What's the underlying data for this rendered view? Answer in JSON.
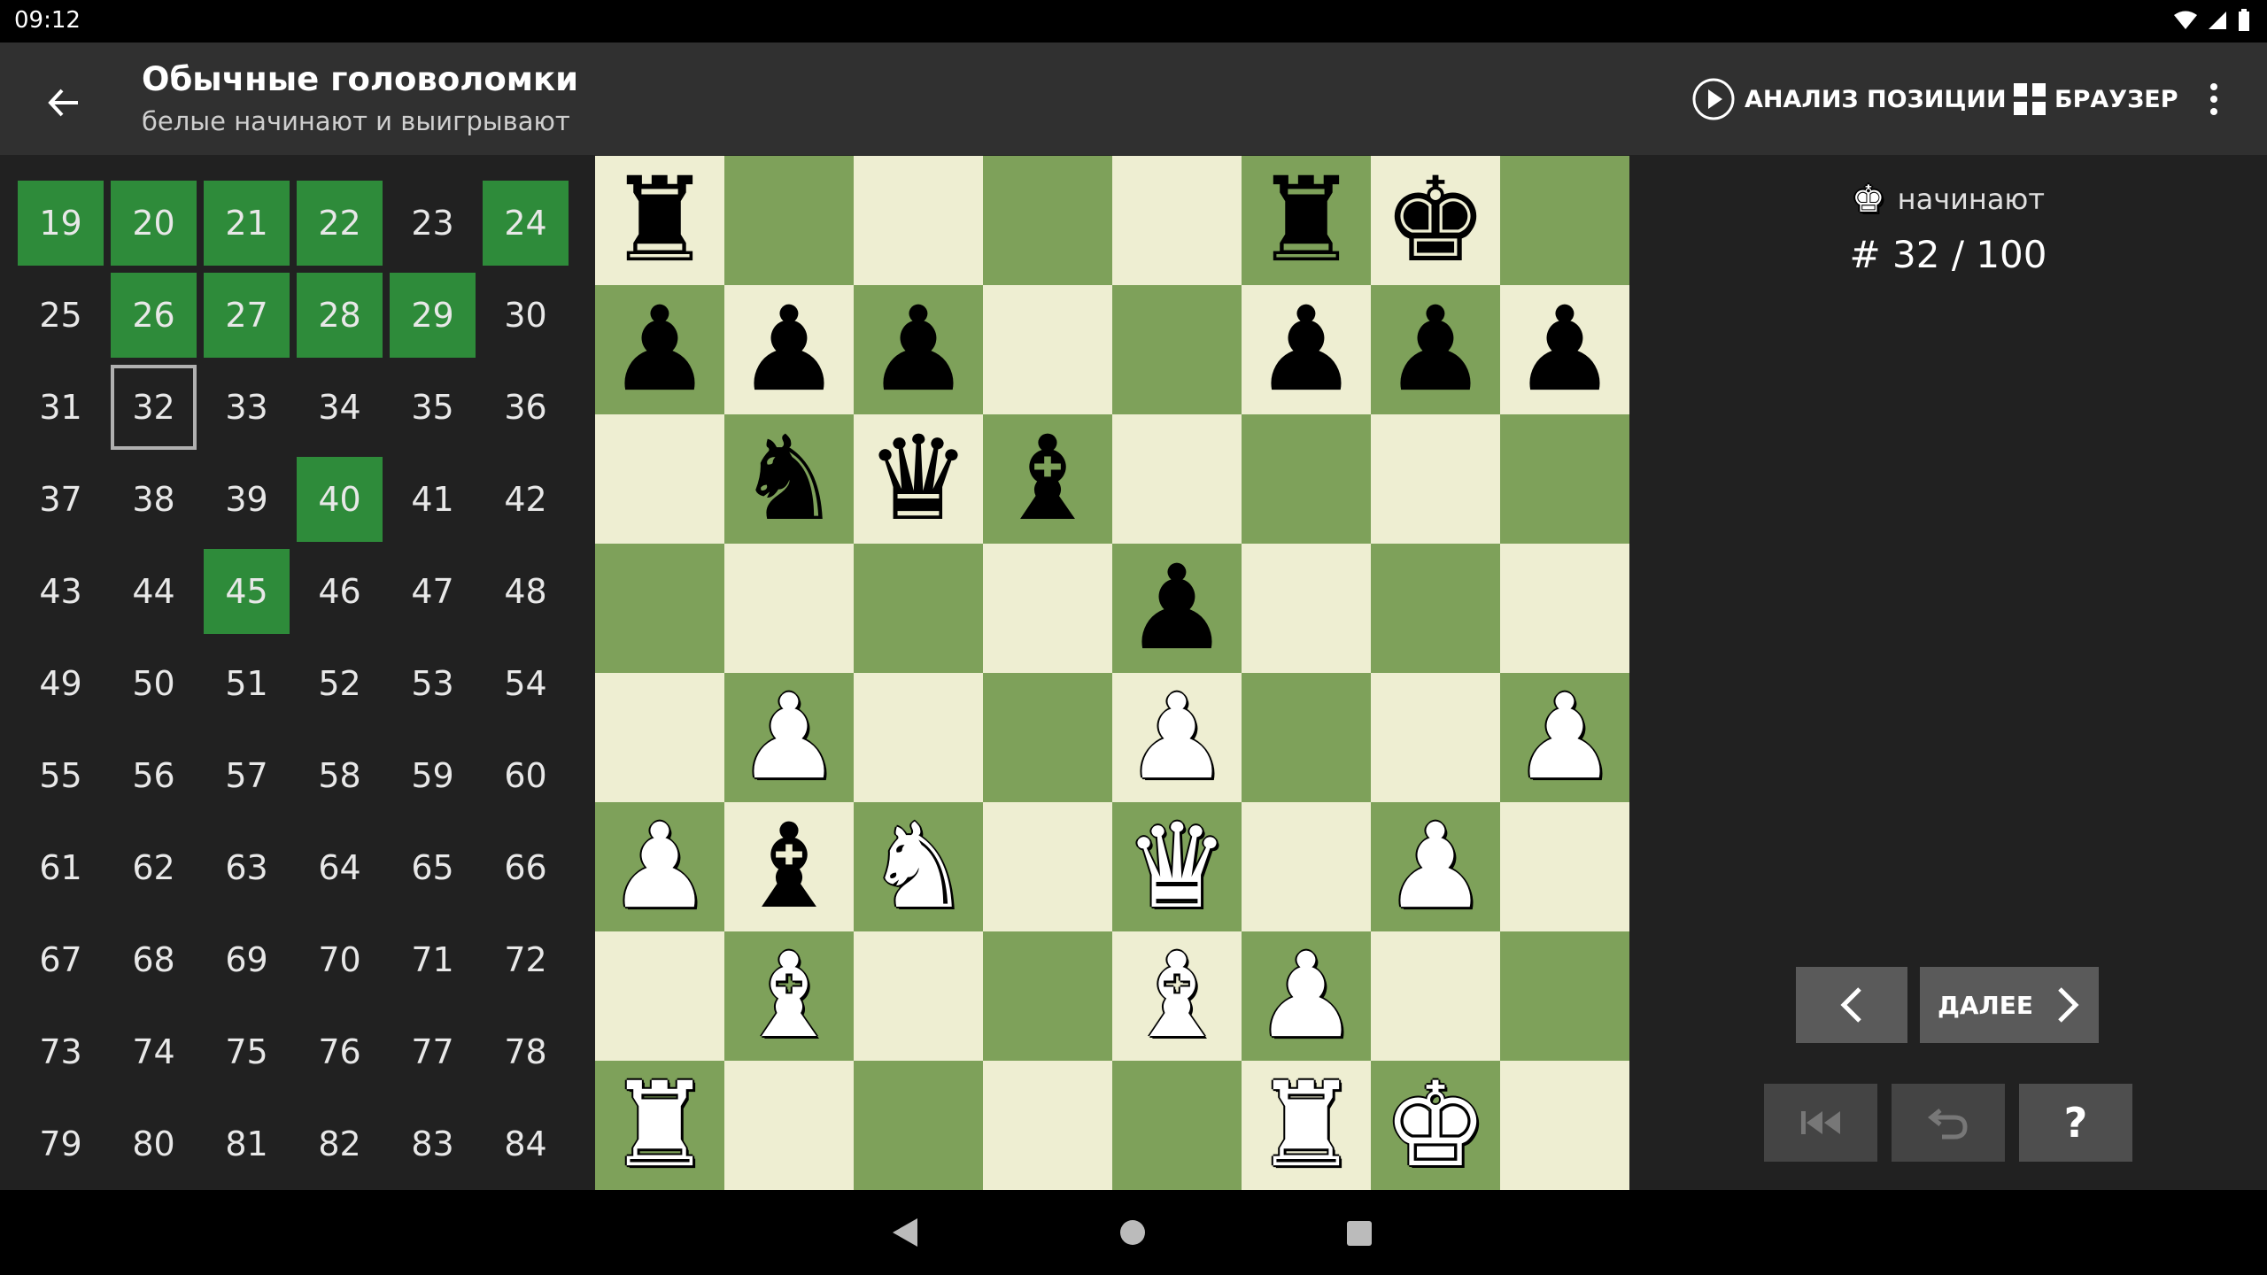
{
  "status": {
    "time": "09:12"
  },
  "header": {
    "title": "Обычные головоломки",
    "subtitle": "белые начинают и выигрывают",
    "analysis_label": "АНАЛИЗ ПОЗИЦИИ",
    "browser_label": "БРАУЗЕР"
  },
  "puzzles": {
    "numbers": [
      19,
      20,
      21,
      22,
      23,
      24,
      25,
      26,
      27,
      28,
      29,
      30,
      31,
      32,
      33,
      34,
      35,
      36,
      37,
      38,
      39,
      40,
      41,
      42,
      43,
      44,
      45,
      46,
      47,
      48,
      49,
      50,
      51,
      52,
      53,
      54,
      55,
      56,
      57,
      58,
      59,
      60,
      61,
      62,
      63,
      64,
      65,
      66,
      67,
      68,
      69,
      70,
      71,
      72,
      73,
      74,
      75,
      76,
      77,
      78,
      79,
      80,
      81,
      82,
      83,
      84
    ],
    "solved": [
      19,
      20,
      21,
      22,
      24,
      26,
      27,
      28,
      29,
      40,
      45
    ],
    "current": 32
  },
  "board": {
    "ranks": [
      "r....rk.",
      "ppp..ppp",
      ".nqb....",
      "....p...",
      ".P..P..P",
      "PbN.Q.P.",
      ".B..BP..",
      "R....RK."
    ]
  },
  "side": {
    "turn_label": "начинают",
    "counter": "# 32 / 100",
    "next_label": "ДАЛЕЕ",
    "hint_label": "?"
  },
  "colors": {
    "solved": "#2e8b3a",
    "light_square": "#eeeed2",
    "dark_square": "#7ea15a"
  }
}
